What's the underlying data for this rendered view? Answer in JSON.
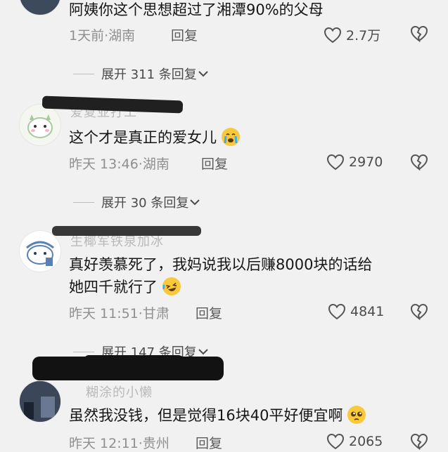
{
  "comments": [
    {
      "text": "阿姨你这个思想超过了湘潭90%的父母",
      "time": "1天前",
      "location": "湖南",
      "reply_label": "回复",
      "likes": "2.7万",
      "expand": "展开 311 条回复"
    },
    {
      "nickname": "爱夏亚打工",
      "text": "这个才是真正的爱女儿",
      "time": "昨天 13:46",
      "location": "湖南",
      "reply_label": "回复",
      "likes": "2970",
      "expand": "展开 30 条回复"
    },
    {
      "nickname": "生椰军铁泉加冰",
      "text_line1": "真好羡慕死了，我妈说我以后赚8000块的话给",
      "text_line2": "她四千就行了",
      "time": "昨天 11:51",
      "location": "甘肃",
      "reply_label": "回复",
      "likes": "4841",
      "expand": "展开 147 条回复"
    },
    {
      "nickname": "糊涂的小懒",
      "text": "虽然我没钱，但是觉得16块40平好便宜啊",
      "time": "昨天 12:11",
      "location": "贵州",
      "reply_label": "回复",
      "likes": "2065"
    }
  ],
  "icons": {
    "like": "heart-outline-icon",
    "dislike": "broken-heart-icon",
    "expand": "chevron-down-icon"
  },
  "colors": {
    "background": "#f1f1f1",
    "text": "#161616",
    "meta": "#8f8f8f"
  }
}
